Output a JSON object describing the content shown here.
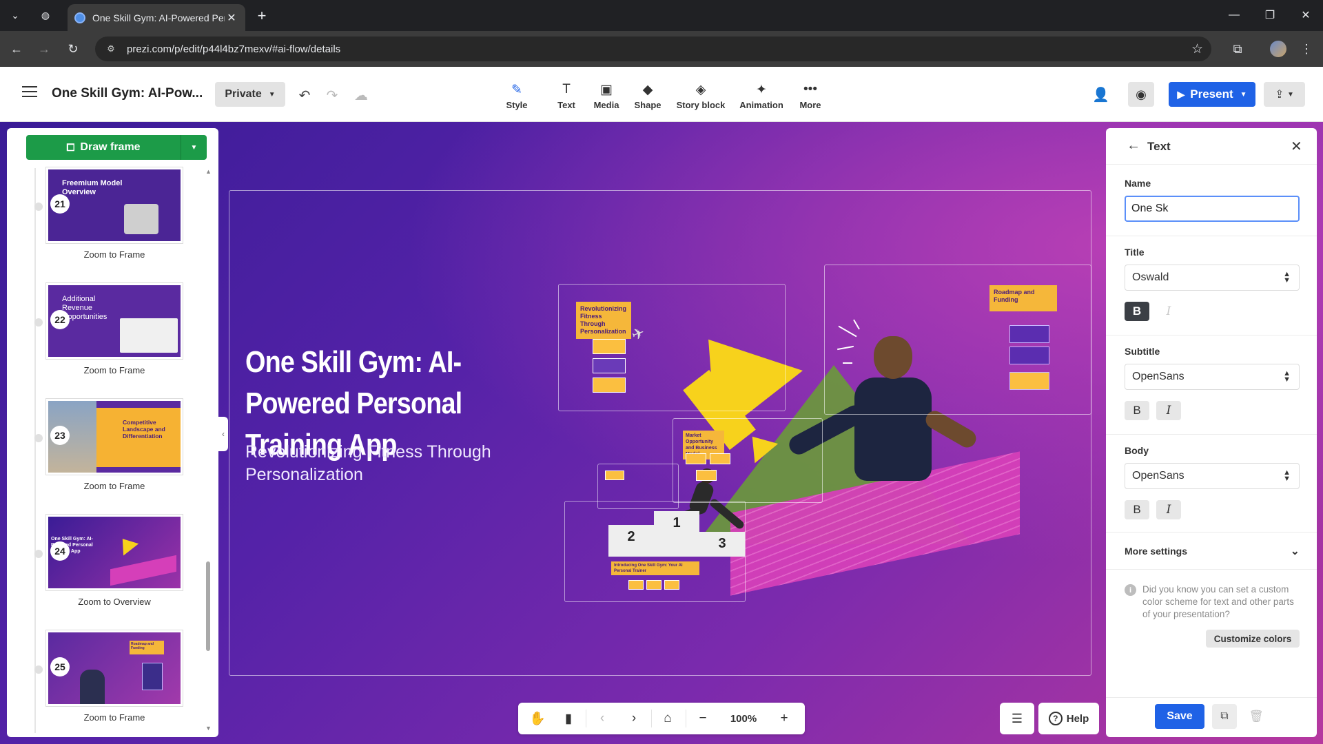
{
  "browser": {
    "tab_title": "One Skill Gym: AI-Powered Pers",
    "url": "prezi.com/p/edit/p44l4bz7mexv/#ai-flow/details"
  },
  "toolbar": {
    "doc_title": "One Skill Gym: AI-Pow...",
    "privacy": "Private",
    "tools": [
      {
        "label": "Style",
        "icon": "brush-icon"
      },
      {
        "label": "Text",
        "icon": "text-icon"
      },
      {
        "label": "Media",
        "icon": "image-icon"
      },
      {
        "label": "Shape",
        "icon": "shapes-icon"
      },
      {
        "label": "Story block",
        "icon": "layers-icon"
      },
      {
        "label": "Animation",
        "icon": "animation-icon"
      },
      {
        "label": "More",
        "icon": "more-icon"
      }
    ],
    "present": "Present"
  },
  "left_panel": {
    "draw_frame": "Draw frame",
    "frames": [
      {
        "number": "21",
        "label": "Zoom to Frame",
        "thumb_title": "Freemium Model Overview",
        "thumb_bg": "#4b2595"
      },
      {
        "number": "22",
        "label": "Zoom to Frame",
        "thumb_title": "Additional Revenue Opportunities",
        "thumb_bg": "#5a2aa0"
      },
      {
        "number": "23",
        "label": "Zoom to Frame",
        "thumb_title": "Competitive Landscape and Differentiation",
        "thumb_bg": "#f6b233"
      },
      {
        "number": "24",
        "label": "Zoom to Overview",
        "thumb_title": "One Skill Gym: AI-Powered Personal Training App",
        "thumb_bg": "#5c25a8"
      },
      {
        "number": "25",
        "label": "Zoom to Frame",
        "thumb_title": "Roadmap and Funding",
        "thumb_bg": "#6a2db0"
      }
    ]
  },
  "canvas": {
    "title": "One Skill Gym: AI-Powered Personal Training App",
    "subtitle": "Revolutionizing Fitness Through Personalization",
    "tag_revolutionizing": "Revolutionizing Fitness Through Personalization",
    "tag_roadmap": "Roadmap and Funding",
    "tag_market": "Market Opportunity and Business Model",
    "tag_intro": "Introducing One Skill Gym: Your AI Personal Trainer",
    "podium_numbers": [
      "2",
      "1",
      "3"
    ]
  },
  "right_panel": {
    "header": "Text",
    "name_label": "Name",
    "name_value": "One Sk",
    "title_label": "Title",
    "title_font": "Oswald",
    "subtitle_label": "Subtitle",
    "subtitle_font": "OpenSans",
    "body_label": "Body",
    "body_font": "OpenSans",
    "bold_glyph": "B",
    "italic_glyph": "I",
    "more_settings": "More settings",
    "info_text": "Did you know you can set a custom color scheme for text and other parts of your presentation?",
    "customize_colors": "Customize colors",
    "save": "Save"
  },
  "bottom_bar": {
    "zoom": "100%",
    "help": "Help"
  },
  "colors": {
    "accent_blue": "#1f62e6",
    "draw_frame_green": "#1c9b48",
    "canvas_purple": "#5422a8",
    "tag_yellow": "#f5b73a"
  }
}
